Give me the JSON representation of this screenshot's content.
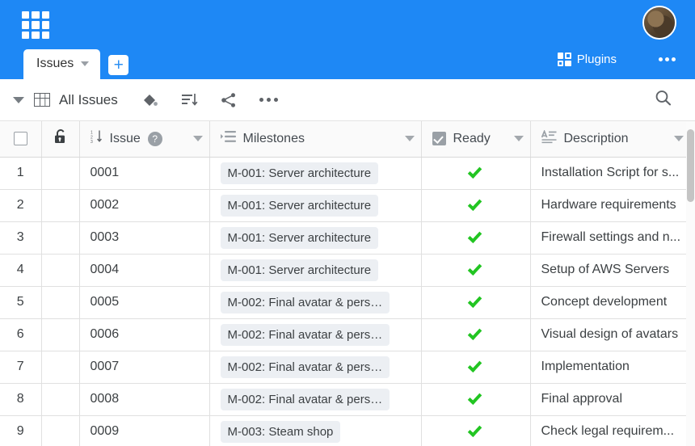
{
  "topbar": {
    "background": "#1e88f5",
    "apps_icon": "waffle-grid-icon",
    "tab_label": "Issues",
    "add_tab_label": "+",
    "plugins_label": "Plugins",
    "more_label": "•••"
  },
  "toolbar": {
    "view_label": "All Issues",
    "icons": [
      "table-view-icon",
      "fill-color-icon",
      "sort-icon",
      "share-icon",
      "more-icon",
      "search-icon"
    ]
  },
  "table": {
    "columns": [
      {
        "key": "num",
        "label": "",
        "icon": "select-all-checkbox",
        "has_caret": false
      },
      {
        "key": "lock",
        "label": "",
        "icon": "unlock-icon",
        "has_caret": false
      },
      {
        "key": "issue",
        "label": "Issue",
        "icon": "numeric-sort-icon",
        "help": "?",
        "has_caret": true
      },
      {
        "key": "ms",
        "label": "Milestones",
        "icon": "list-icon",
        "has_caret": true
      },
      {
        "key": "ready",
        "label": "Ready",
        "icon": "checkbox-icon",
        "has_caret": true
      },
      {
        "key": "desc",
        "label": "Description",
        "icon": "text-format-icon",
        "has_caret": true
      }
    ],
    "rows": [
      {
        "num": "1",
        "issue": "0001",
        "milestone": "M-001: Server architecture",
        "ready": true,
        "description": "Installation Script for s..."
      },
      {
        "num": "2",
        "issue": "0002",
        "milestone": "M-001: Server architecture",
        "ready": true,
        "description": "Hardware requirements"
      },
      {
        "num": "3",
        "issue": "0003",
        "milestone": "M-001: Server architecture",
        "ready": true,
        "description": "Firewall settings and n..."
      },
      {
        "num": "4",
        "issue": "0004",
        "milestone": "M-001: Server architecture",
        "ready": true,
        "description": "Setup of AWS Servers"
      },
      {
        "num": "5",
        "issue": "0005",
        "milestone": "M-002: Final avatar & pers…",
        "ready": true,
        "description": "Concept development"
      },
      {
        "num": "6",
        "issue": "0006",
        "milestone": "M-002: Final avatar & pers…",
        "ready": true,
        "description": "Visual design of avatars"
      },
      {
        "num": "7",
        "issue": "0007",
        "milestone": "M-002: Final avatar & pers…",
        "ready": true,
        "description": "Implementation"
      },
      {
        "num": "8",
        "issue": "0008",
        "milestone": "M-002: Final avatar & pers…",
        "ready": true,
        "description": "Final approval"
      },
      {
        "num": "9",
        "issue": "0009",
        "milestone": "M-003: Steam shop",
        "ready": true,
        "description": "Check legal requirem..."
      }
    ]
  },
  "colors": {
    "accent": "#1e88f5",
    "check_green": "#22c522",
    "badge_bg": "#eceff3",
    "border": "#e0e0e0"
  }
}
